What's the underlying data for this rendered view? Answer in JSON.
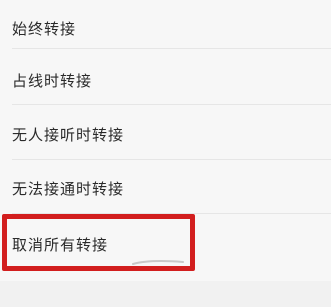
{
  "menu": {
    "items": [
      {
        "label": "始终转接"
      },
      {
        "label": "占线时转接"
      },
      {
        "label": "无人接听时转接"
      },
      {
        "label": "无法接通时转接"
      },
      {
        "label": "取消所有转接"
      }
    ]
  },
  "colors": {
    "highlight": "#d21e1e",
    "text": "#2a2a2a",
    "background": "#f7f7f7"
  }
}
